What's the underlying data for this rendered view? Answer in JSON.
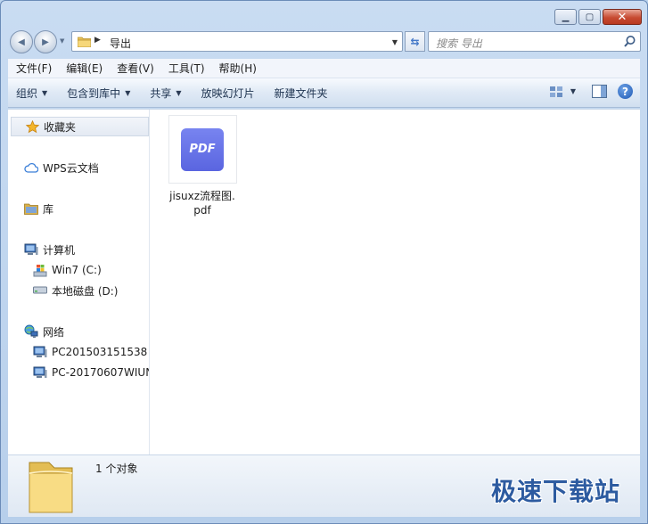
{
  "window": {
    "controls": {
      "minimize": "▁",
      "maximize": "▢",
      "close": "✕"
    }
  },
  "nav": {
    "back_glyph": "◀",
    "forward_glyph": "▶",
    "address_separator": "▶",
    "address_path": "导出",
    "search_placeholder": "搜索 导出"
  },
  "menubar": {
    "items": [
      "文件(F)",
      "编辑(E)",
      "查看(V)",
      "工具(T)",
      "帮助(H)"
    ]
  },
  "toolbar": {
    "organize": "组织",
    "include_in_library": "包含到库中",
    "share": "共享",
    "slideshow": "放映幻灯片",
    "new_folder": "新建文件夹",
    "help_glyph": "?"
  },
  "sidebar": {
    "favorites": "收藏夹",
    "wps_cloud": "WPS云文档",
    "libraries": "库",
    "computer": "计算机",
    "drive_c": "Win7 (C:)",
    "drive_d": "本地磁盘 (D:)",
    "network": "网络",
    "pc1": "PC201503151538",
    "pc2": "PC-20170607WIUN"
  },
  "files": [
    {
      "name": "jisuxz流程图.pdf",
      "badge": "PDF",
      "type": "pdf"
    }
  ],
  "details": {
    "count_text": "1 个对象"
  },
  "watermark": "极速下载站",
  "colors": {
    "pdf_badge": "#6470e8",
    "watermark": "#2d5ba0",
    "close_button": "#c74b32"
  }
}
